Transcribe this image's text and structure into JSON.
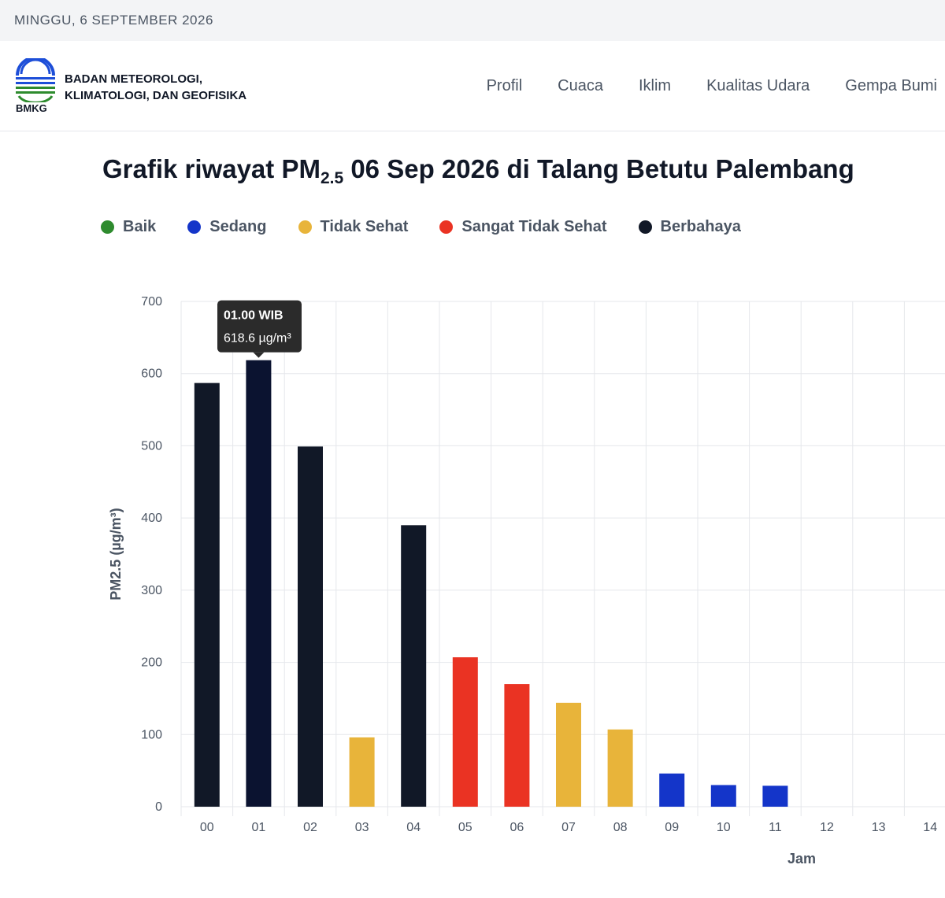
{
  "topbar": {
    "date": "MINGGU, 6 SEPTEMBER 2026"
  },
  "header": {
    "logo_text": "BMKG",
    "org_line1": "BADAN METEOROLOGI,",
    "org_line2": "KLIMATOLOGI, DAN GEOFISIKA",
    "nav": [
      "Profil",
      "Cuaca",
      "Iklim",
      "Kualitas Udara",
      "Gempa Bumi"
    ]
  },
  "title": {
    "prefix": "Grafik riwayat PM",
    "sub": "2.5",
    "suffix": " 06 Sep 2026 di Talang Betutu Palembang"
  },
  "legend": [
    {
      "label": "Baik",
      "color": "#2e8b2e"
    },
    {
      "label": "Sedang",
      "color": "#1435c9"
    },
    {
      "label": "Tidak Sehat",
      "color": "#e8b43a"
    },
    {
      "label": "Sangat Tidak Sehat",
      "color": "#ea3323"
    },
    {
      "label": "Berbahaya",
      "color": "#111827"
    }
  ],
  "tooltip": {
    "title": "01.00 WIB",
    "value": "618.6 µg/m³",
    "index": 1
  },
  "chart_data": {
    "type": "bar",
    "xlabel": "Jam",
    "ylabel": "PM2.5 (µg/m³)",
    "ylim": [
      0,
      700
    ],
    "yticks": [
      0,
      100,
      200,
      300,
      400,
      500,
      600,
      700
    ],
    "grid": true,
    "categories": [
      "00",
      "01",
      "02",
      "03",
      "04",
      "05",
      "06",
      "07",
      "08",
      "09",
      "10",
      "11",
      "12",
      "13",
      "14"
    ],
    "values": [
      587,
      618.6,
      499,
      96,
      390,
      207,
      170,
      144,
      107,
      46,
      30,
      29,
      null,
      null,
      null
    ],
    "bar_colors": [
      "#111827",
      "#0b1330",
      "#111827",
      "#e8b43a",
      "#111827",
      "#ea3323",
      "#ea3323",
      "#e8b43a",
      "#e8b43a",
      "#1435c9",
      "#1435c9",
      "#1435c9",
      "",
      "",
      ""
    ]
  }
}
